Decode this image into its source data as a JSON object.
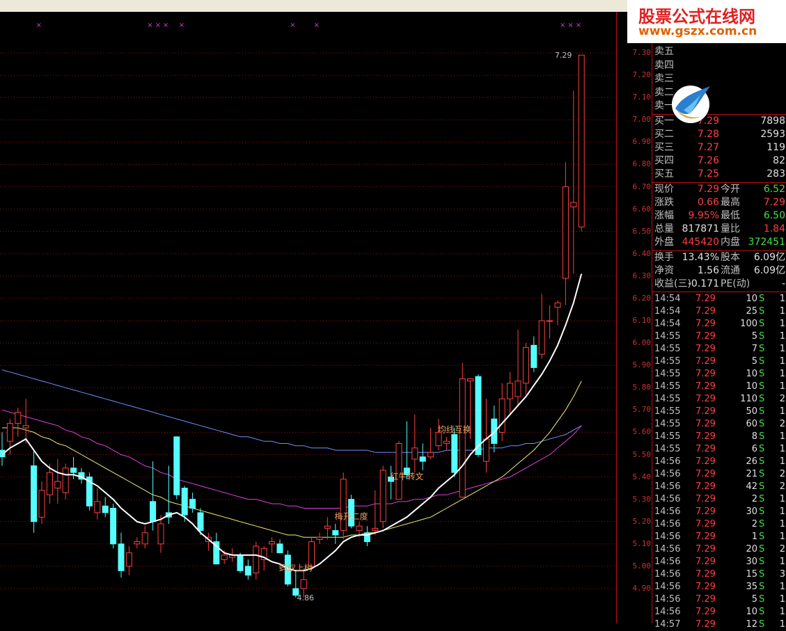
{
  "colors": {
    "up": "#ff4040",
    "down": "#55ffff",
    "ma_white": "#ffffff",
    "ma_yellow": "#f0f070",
    "ma_magenta": "#e040e0",
    "ma_blue": "#7090ff",
    "grid": "#a01010",
    "annotation": "#e8a060"
  },
  "chart_data": {
    "type": "candlestick",
    "ylim": [
      4.8,
      7.38
    ],
    "yticks": [
      "7.30",
      "7.20",
      "7.10",
      "7.00",
      "6.90",
      "6.80",
      "6.70",
      "6.60",
      "6.50",
      "6.40",
      "6.30",
      "6.20",
      "6.10",
      "6.00",
      "5.90",
      "5.80",
      "5.70",
      "5.60",
      "5.50",
      "5.40",
      "5.30",
      "5.20",
      "5.10",
      "5.00",
      "4.90"
    ],
    "candles": [
      {
        "o": 5.52,
        "h": 5.6,
        "l": 5.45,
        "c": 5.49
      },
      {
        "o": 5.56,
        "h": 5.66,
        "l": 5.5,
        "c": 5.64
      },
      {
        "o": 5.64,
        "h": 5.71,
        "l": 5.58,
        "c": 5.69
      },
      {
        "o": 5.62,
        "h": 5.75,
        "l": 5.55,
        "c": 5.63
      },
      {
        "o": 5.45,
        "h": 5.52,
        "l": 5.15,
        "c": 5.2
      },
      {
        "o": 5.22,
        "h": 5.38,
        "l": 5.19,
        "c": 5.34
      },
      {
        "o": 5.32,
        "h": 5.46,
        "l": 5.28,
        "c": 5.42
      },
      {
        "o": 5.35,
        "h": 5.48,
        "l": 5.28,
        "c": 5.38
      },
      {
        "o": 5.33,
        "h": 5.46,
        "l": 5.3,
        "c": 5.44
      },
      {
        "o": 5.44,
        "h": 5.49,
        "l": 5.39,
        "c": 5.42
      },
      {
        "o": 5.42,
        "h": 5.44,
        "l": 5.37,
        "c": 5.39
      },
      {
        "o": 5.4,
        "h": 5.42,
        "l": 5.25,
        "c": 5.27
      },
      {
        "o": 5.24,
        "h": 5.35,
        "l": 5.21,
        "c": 5.29
      },
      {
        "o": 5.27,
        "h": 5.31,
        "l": 5.22,
        "c": 5.24
      },
      {
        "o": 5.26,
        "h": 5.28,
        "l": 5.08,
        "c": 5.1
      },
      {
        "o": 5.1,
        "h": 5.15,
        "l": 4.95,
        "c": 4.98
      },
      {
        "o": 5.0,
        "h": 5.09,
        "l": 4.96,
        "c": 5.06
      },
      {
        "o": 5.1,
        "h": 5.13,
        "l": 5.08,
        "c": 5.11
      },
      {
        "o": 5.1,
        "h": 5.18,
        "l": 5.08,
        "c": 5.15
      },
      {
        "o": 5.29,
        "h": 5.47,
        "l": 5.16,
        "c": 5.2
      },
      {
        "o": 5.1,
        "h": 5.23,
        "l": 5.06,
        "c": 5.19
      },
      {
        "o": 5.24,
        "h": 5.45,
        "l": 5.19,
        "c": 5.22
      },
      {
        "o": 5.58,
        "h": 5.58,
        "l": 5.3,
        "c": 5.32
      },
      {
        "o": 5.35,
        "h": 5.36,
        "l": 5.2,
        "c": 5.23
      },
      {
        "o": 5.3,
        "h": 5.33,
        "l": 5.24,
        "c": 5.26
      },
      {
        "o": 5.24,
        "h": 5.26,
        "l": 5.14,
        "c": 5.16
      },
      {
        "o": 5.11,
        "h": 5.15,
        "l": 5.07,
        "c": 5.13
      },
      {
        "o": 5.11,
        "h": 5.15,
        "l": 5.01,
        "c": 5.01
      },
      {
        "o": 5.03,
        "h": 5.07,
        "l": 5.01,
        "c": 5.05
      },
      {
        "o": 5.04,
        "h": 5.08,
        "l": 5.02,
        "c": 5.05
      },
      {
        "o": 5.05,
        "h": 5.06,
        "l": 4.97,
        "c": 4.98
      },
      {
        "o": 5.0,
        "h": 5.03,
        "l": 4.94,
        "c": 4.96
      },
      {
        "o": 4.97,
        "h": 5.11,
        "l": 4.94,
        "c": 5.09
      },
      {
        "o": 5.03,
        "h": 5.09,
        "l": 4.98,
        "c": 5.08
      },
      {
        "o": 5.1,
        "h": 5.13,
        "l": 5.06,
        "c": 5.11
      },
      {
        "o": 5.1,
        "h": 5.12,
        "l": 5.06,
        "c": 5.06
      },
      {
        "o": 5.05,
        "h": 5.07,
        "l": 4.91,
        "c": 4.92
      },
      {
        "o": 4.9,
        "h": 4.98,
        "l": 4.86,
        "c": 4.87
      },
      {
        "o": 4.9,
        "h": 4.99,
        "l": 4.86,
        "c": 4.94
      },
      {
        "o": 5.0,
        "h": 5.13,
        "l": 4.98,
        "c": 5.11
      },
      {
        "o": 5.12,
        "h": 5.15,
        "l": 5.1,
        "c": 5.13
      },
      {
        "o": 5.17,
        "h": 5.22,
        "l": 5.12,
        "c": 5.18
      },
      {
        "o": 5.16,
        "h": 5.19,
        "l": 5.1,
        "c": 5.14
      },
      {
        "o": 5.16,
        "h": 5.42,
        "l": 5.12,
        "c": 5.39
      },
      {
        "o": 5.3,
        "h": 5.32,
        "l": 5.17,
        "c": 5.18
      },
      {
        "o": 5.16,
        "h": 5.2,
        "l": 5.13,
        "c": 5.18
      },
      {
        "o": 5.15,
        "h": 5.18,
        "l": 5.09,
        "c": 5.11
      },
      {
        "o": 5.16,
        "h": 5.34,
        "l": 5.14,
        "c": 5.17
      },
      {
        "o": 5.2,
        "h": 5.45,
        "l": 5.17,
        "c": 5.43
      },
      {
        "o": 5.4,
        "h": 5.45,
        "l": 5.3,
        "c": 5.38
      },
      {
        "o": 5.3,
        "h": 5.56,
        "l": 5.3,
        "c": 5.55
      },
      {
        "o": 5.44,
        "h": 5.65,
        "l": 5.39,
        "c": 5.41
      },
      {
        "o": 5.48,
        "h": 5.68,
        "l": 5.42,
        "c": 5.53
      },
      {
        "o": 5.49,
        "h": 5.55,
        "l": 5.43,
        "c": 5.47
      },
      {
        "o": 5.49,
        "h": 5.62,
        "l": 5.48,
        "c": 5.51
      },
      {
        "o": 5.54,
        "h": 5.66,
        "l": 5.52,
        "c": 5.6
      },
      {
        "o": 5.55,
        "h": 5.58,
        "l": 5.52,
        "c": 5.56
      },
      {
        "o": 5.59,
        "h": 5.62,
        "l": 5.4,
        "c": 5.42
      },
      {
        "o": 5.31,
        "h": 5.91,
        "l": 5.31,
        "c": 5.84
      },
      {
        "o": 5.83,
        "h": 5.84,
        "l": 5.57,
        "c": 5.84
      },
      {
        "o": 5.85,
        "h": 5.86,
        "l": 5.49,
        "c": 5.5
      },
      {
        "o": 5.47,
        "h": 5.75,
        "l": 5.42,
        "c": 5.57
      },
      {
        "o": 5.66,
        "h": 5.72,
        "l": 5.51,
        "c": 5.55
      },
      {
        "o": 5.6,
        "h": 5.82,
        "l": 5.56,
        "c": 5.75
      },
      {
        "o": 5.75,
        "h": 5.87,
        "l": 5.68,
        "c": 5.82
      },
      {
        "o": 5.76,
        "h": 6.06,
        "l": 5.72,
        "c": 5.83
      },
      {
        "o": 5.82,
        "h": 6.0,
        "l": 5.77,
        "c": 5.98
      },
      {
        "o": 5.99,
        "h": 6.03,
        "l": 5.87,
        "c": 5.89
      },
      {
        "o": 5.95,
        "h": 6.22,
        "l": 5.93,
        "c": 6.1
      },
      {
        "o": 6.1,
        "h": 6.17,
        "l": 6.02,
        "c": 6.1
      },
      {
        "o": 6.16,
        "h": 6.19,
        "l": 6.08,
        "c": 6.18
      },
      {
        "o": 6.29,
        "h": 6.81,
        "l": 6.17,
        "c": 6.7
      },
      {
        "o": 6.61,
        "h": 7.13,
        "l": 6.31,
        "c": 6.63
      },
      {
        "o": 6.52,
        "h": 7.29,
        "l": 6.5,
        "c": 7.29
      }
    ],
    "ma_white": [
      5.5,
      5.53,
      5.55,
      5.57,
      5.52,
      5.47,
      5.44,
      5.42,
      5.41,
      5.41,
      5.4,
      5.38,
      5.36,
      5.33,
      5.3,
      5.26,
      5.23,
      5.2,
      5.19,
      5.2,
      5.21,
      5.23,
      5.24,
      5.22,
      5.19,
      5.15,
      5.12,
      5.09,
      5.06,
      5.05,
      5.05,
      5.05,
      5.05,
      5.04,
      5.02,
      5.01,
      4.99,
      4.98,
      4.98,
      4.99,
      5.01,
      5.04,
      5.07,
      5.11,
      5.13,
      5.14,
      5.14,
      5.15,
      5.16,
      5.18,
      5.2,
      5.22,
      5.25,
      5.28,
      5.31,
      5.35,
      5.38,
      5.41,
      5.45,
      5.5,
      5.54,
      5.57,
      5.6,
      5.64,
      5.68,
      5.72,
      5.76,
      5.81,
      5.86,
      5.92,
      5.99,
      6.08,
      6.18,
      6.31
    ],
    "ma_yellow": [
      5.62,
      5.62,
      5.62,
      5.61,
      5.6,
      5.58,
      5.57,
      5.55,
      5.54,
      5.52,
      5.5,
      5.48,
      5.46,
      5.44,
      5.42,
      5.4,
      5.38,
      5.36,
      5.34,
      5.32,
      5.31,
      5.29,
      5.28,
      5.27,
      5.26,
      5.25,
      5.24,
      5.23,
      5.22,
      5.21,
      5.2,
      5.19,
      5.18,
      5.17,
      5.16,
      5.15,
      5.14,
      5.14,
      5.13,
      5.13,
      5.13,
      5.13,
      5.13,
      5.13,
      5.14,
      5.14,
      5.15,
      5.15,
      5.16,
      5.17,
      5.18,
      5.19,
      5.2,
      5.21,
      5.22,
      5.24,
      5.26,
      5.28,
      5.3,
      5.32,
      5.34,
      5.36,
      5.38,
      5.4,
      5.43,
      5.46,
      5.49,
      5.52,
      5.56,
      5.6,
      5.65,
      5.7,
      5.76,
      5.83
    ],
    "ma_magenta": [
      5.7,
      5.69,
      5.68,
      5.67,
      5.66,
      5.65,
      5.64,
      5.63,
      5.61,
      5.6,
      5.58,
      5.57,
      5.55,
      5.54,
      5.52,
      5.5,
      5.49,
      5.47,
      5.45,
      5.44,
      5.42,
      5.41,
      5.39,
      5.38,
      5.37,
      5.36,
      5.35,
      5.34,
      5.33,
      5.32,
      5.31,
      5.3,
      5.3,
      5.29,
      5.28,
      5.28,
      5.27,
      5.27,
      5.26,
      5.26,
      5.26,
      5.26,
      5.26,
      5.26,
      5.27,
      5.27,
      5.27,
      5.28,
      5.28,
      5.28,
      5.29,
      5.29,
      5.3,
      5.3,
      5.31,
      5.32,
      5.32,
      5.33,
      5.34,
      5.35,
      5.36,
      5.37,
      5.38,
      5.39,
      5.4,
      5.42,
      5.44,
      5.46,
      5.48,
      5.5,
      5.53,
      5.56,
      5.59,
      5.63
    ],
    "ma_blue": [
      5.88,
      5.87,
      5.86,
      5.85,
      5.84,
      5.83,
      5.82,
      5.81,
      5.8,
      5.79,
      5.78,
      5.77,
      5.76,
      5.75,
      5.74,
      5.73,
      5.72,
      5.71,
      5.7,
      5.69,
      5.68,
      5.67,
      5.66,
      5.65,
      5.64,
      5.63,
      5.62,
      5.61,
      5.6,
      5.59,
      5.58,
      5.58,
      5.57,
      5.56,
      5.56,
      5.55,
      5.55,
      5.54,
      5.54,
      5.53,
      5.53,
      5.53,
      5.52,
      5.52,
      5.52,
      5.52,
      5.52,
      5.51,
      5.51,
      5.51,
      5.51,
      5.51,
      5.51,
      5.51,
      5.51,
      5.51,
      5.52,
      5.52,
      5.52,
      5.52,
      5.52,
      5.53,
      5.53,
      5.53,
      5.54,
      5.54,
      5.55,
      5.55,
      5.56,
      5.57,
      5.58,
      5.59,
      5.61,
      5.63
    ],
    "signal_marks": [
      2,
      16,
      17,
      18,
      20,
      34,
      37,
      68,
      69,
      70
    ],
    "annotations": [
      {
        "text": "蚂蚁上树",
        "i": 37,
        "y": 4.98
      },
      {
        "text": "均线互换",
        "i": 57,
        "y": 5.6
      },
      {
        "text": "红牛转文",
        "i": 51,
        "y": 5.39
      },
      {
        "text": "梅开二度",
        "i": 44,
        "y": 5.21
      }
    ],
    "price_labels": [
      {
        "text": "7.29",
        "i": 73,
        "y": 7.29
      },
      {
        "text": "4.86",
        "i": 37,
        "y": 4.86
      }
    ]
  },
  "quote_panel": {
    "sell": [
      {
        "label": "卖五",
        "price": "",
        "vol": ""
      },
      {
        "label": "卖四",
        "price": "",
        "vol": ""
      },
      {
        "label": "卖三",
        "price": "",
        "vol": ""
      },
      {
        "label": "卖二",
        "price": "",
        "vol": ""
      },
      {
        "label": "卖一",
        "price": "",
        "vol": ""
      }
    ],
    "buy": [
      {
        "label": "买一",
        "price": "7.29",
        "vol": "7898"
      },
      {
        "label": "买二",
        "price": "7.28",
        "vol": "2593"
      },
      {
        "label": "买三",
        "price": "7.27",
        "vol": "119"
      },
      {
        "label": "买四",
        "price": "7.26",
        "vol": "82"
      },
      {
        "label": "买五",
        "price": "7.25",
        "vol": "283"
      }
    ],
    "stats": [
      {
        "l1": "现价",
        "v1": "7.29",
        "c1": "red",
        "l2": "今开",
        "v2": "6.52",
        "c2": "green"
      },
      {
        "l1": "涨跌",
        "v1": "0.66",
        "c1": "red",
        "l2": "最高",
        "v2": "7.29",
        "c2": "red"
      },
      {
        "l1": "涨幅",
        "v1": "9.95%",
        "c1": "red",
        "l2": "最低",
        "v2": "6.50",
        "c2": "green"
      },
      {
        "l1": "总量",
        "v1": "817871",
        "c1": "white",
        "l2": "量比",
        "v2": "1.84",
        "c2": "red"
      },
      {
        "l1": "外盘",
        "v1": "445420",
        "c1": "red",
        "l2": "内盘",
        "v2": "372451",
        "c2": "green"
      }
    ],
    "stats2": [
      {
        "l1": "换手",
        "v1": "13.43%",
        "c1": "white",
        "l2": "股本",
        "v2": "6.09亿",
        "c2": "white"
      },
      {
        "l1": "净资",
        "v1": "1.56",
        "c1": "white",
        "l2": "流通",
        "v2": "6.09亿",
        "c2": "white"
      },
      {
        "l1": "收益(三)",
        "v1": "-0.171",
        "c1": "white",
        "l2": "PE(动)",
        "v2": "-",
        "c2": "white"
      }
    ],
    "ticks": [
      {
        "t": "14:54",
        "p": "7.29",
        "v": "10",
        "f": "S",
        "n": "1"
      },
      {
        "t": "14:54",
        "p": "7.29",
        "v": "25",
        "f": "S",
        "n": "1"
      },
      {
        "t": "14:54",
        "p": "7.29",
        "v": "100",
        "f": "S",
        "n": "1"
      },
      {
        "t": "14:55",
        "p": "7.29",
        "v": "5",
        "f": "S",
        "n": "1"
      },
      {
        "t": "14:55",
        "p": "7.29",
        "v": "7",
        "f": "S",
        "n": "1"
      },
      {
        "t": "14:55",
        "p": "7.29",
        "v": "5",
        "f": "S",
        "n": "1"
      },
      {
        "t": "14:55",
        "p": "7.29",
        "v": "10",
        "f": "S",
        "n": "1"
      },
      {
        "t": "14:55",
        "p": "7.29",
        "v": "10",
        "f": "S",
        "n": "1"
      },
      {
        "t": "14:55",
        "p": "7.29",
        "v": "110",
        "f": "S",
        "n": "2"
      },
      {
        "t": "14:55",
        "p": "7.29",
        "v": "50",
        "f": "S",
        "n": "1"
      },
      {
        "t": "14:55",
        "p": "7.29",
        "v": "60",
        "f": "S",
        "n": "2"
      },
      {
        "t": "14:55",
        "p": "7.29",
        "v": "8",
        "f": "S",
        "n": "1"
      },
      {
        "t": "14:55",
        "p": "7.29",
        "v": "6",
        "f": "S",
        "n": "1"
      },
      {
        "t": "14:56",
        "p": "7.29",
        "v": "26",
        "f": "S",
        "n": "1"
      },
      {
        "t": "14:56",
        "p": "7.29",
        "v": "21",
        "f": "S",
        "n": "2"
      },
      {
        "t": "14:56",
        "p": "7.29",
        "v": "42",
        "f": "S",
        "n": "2"
      },
      {
        "t": "14:56",
        "p": "7.29",
        "v": "2",
        "f": "S",
        "n": "1"
      },
      {
        "t": "14:56",
        "p": "7.29",
        "v": "30",
        "f": "S",
        "n": "1"
      },
      {
        "t": "14:56",
        "p": "7.29",
        "v": "2",
        "f": "S",
        "n": "1"
      },
      {
        "t": "14:56",
        "p": "7.29",
        "v": "1",
        "f": "S",
        "n": "1"
      },
      {
        "t": "14:56",
        "p": "7.29",
        "v": "20",
        "f": "S",
        "n": "2"
      },
      {
        "t": "14:56",
        "p": "7.29",
        "v": "30",
        "f": "S",
        "n": "1"
      },
      {
        "t": "14:56",
        "p": "7.29",
        "v": "15",
        "f": "S",
        "n": "3"
      },
      {
        "t": "14:56",
        "p": "7.29",
        "v": "35",
        "f": "S",
        "n": "1"
      },
      {
        "t": "14:56",
        "p": "7.29",
        "v": "5",
        "f": "S",
        "n": "1"
      },
      {
        "t": "14:56",
        "p": "7.29",
        "v": "10",
        "f": "S",
        "n": "1"
      },
      {
        "t": "14:57",
        "p": "7.29",
        "v": "12",
        "f": "S",
        "n": "1"
      }
    ]
  },
  "watermark": {
    "title": "股票公式在线网",
    "url": "www.gszx.com.cn"
  },
  "logo": "bird-logo-icon"
}
